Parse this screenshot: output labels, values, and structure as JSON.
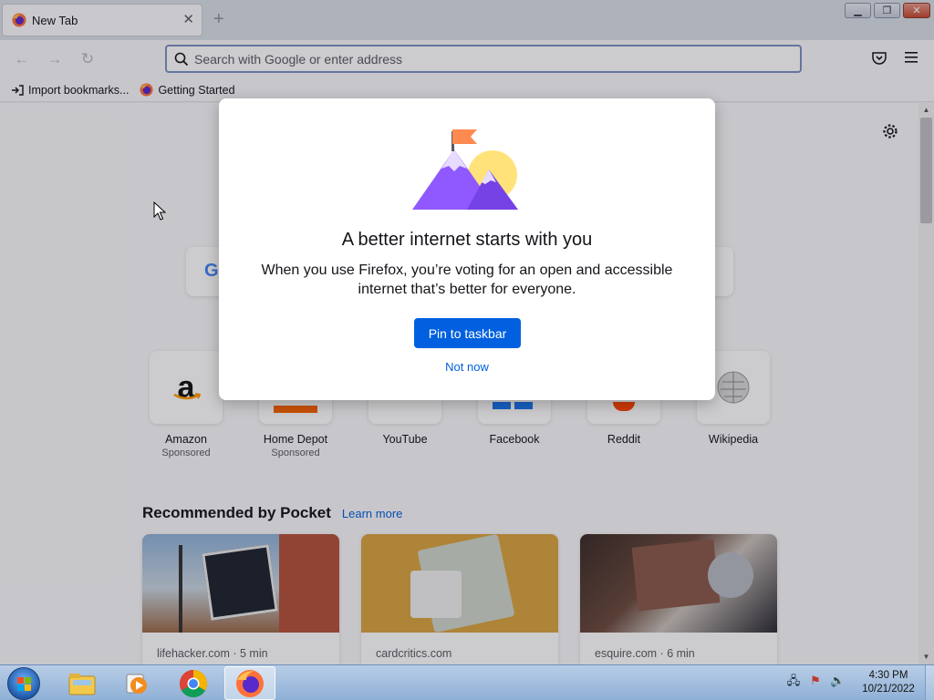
{
  "window": {
    "tab_title": "New Tab",
    "tab_close": "✕",
    "new_tab": "+",
    "controls": {
      "minimize": "▬",
      "restore": "❐",
      "close": "✕"
    }
  },
  "toolbar": {
    "back": "←",
    "forward": "→",
    "reload": "↻",
    "url_placeholder": "Search with Google or enter address",
    "url_value": ""
  },
  "bookmarks": [
    {
      "label": "Import bookmarks..."
    },
    {
      "label": "Getting Started"
    }
  ],
  "content": {
    "search_logo": "G",
    "top_sites": [
      {
        "name": "Amazon",
        "sponsored": "Sponsored"
      },
      {
        "name": "Home Depot",
        "sponsored": "Sponsored"
      },
      {
        "name": "YouTube",
        "sponsored": ""
      },
      {
        "name": "Facebook",
        "sponsored": ""
      },
      {
        "name": "Reddit",
        "sponsored": ""
      },
      {
        "name": "Wikipedia",
        "sponsored": ""
      }
    ],
    "amazon_logo": "a",
    "pocket": {
      "title": "Recommended by Pocket",
      "learn_more": "Learn more",
      "cards": [
        {
          "source": "lifehacker.com · 5 min"
        },
        {
          "source": "cardcritics.com"
        },
        {
          "source": "esquire.com · 6 min"
        }
      ]
    }
  },
  "modal": {
    "title": "A better internet starts with you",
    "subtitle": "When you use Firefox, you’re voting for an open and accessible internet that’s better for everyone.",
    "primary_button": "Pin to taskbar",
    "secondary_link": "Not now"
  },
  "taskbar": {
    "time": "4:30 PM",
    "date": "10/21/2022"
  },
  "colors": {
    "accent": "#0060df",
    "modal_bg": "#ffffff",
    "taskbar": "#a9c2e0"
  }
}
